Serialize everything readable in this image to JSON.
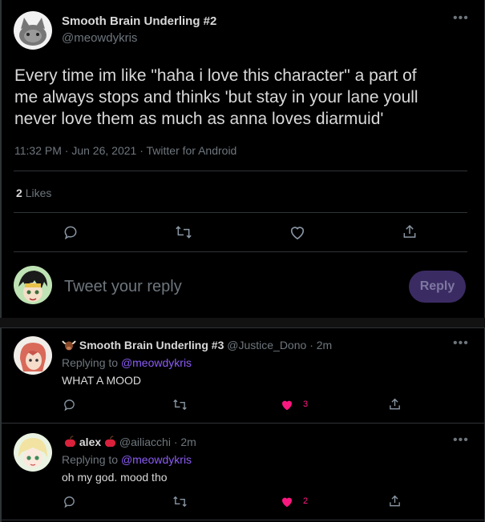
{
  "main_tweet": {
    "display_name": "Smooth Brain Underling #2",
    "handle": "@meowdykris",
    "text_lines": [
      "Every time im like \"haha i love this character\" a part of",
      "me always stops and thinks 'but stay in your lane youll",
      "never love them as much as anna loves diarmuid'"
    ],
    "time": "11:32 PM",
    "date": "Jun 26, 2021",
    "source": "Twitter for Android",
    "likes_count": "2",
    "likes_label": "Likes"
  },
  "reply_box": {
    "placeholder": "Tweet your reply",
    "button_label": "Reply"
  },
  "replies": [
    {
      "display_name": "Smooth Brain Underling #3",
      "handle": "@Justice_Dono",
      "time": "2m",
      "replying_prefix": "Replying to",
      "replying_to": "@meowdykris",
      "text": "WHAT A MOOD",
      "likes": "3"
    },
    {
      "display_name": "alex",
      "handle": "@ailiacchi",
      "time": "2m",
      "replying_prefix": "Replying to",
      "replying_to": "@meowdykris",
      "text": "oh my god. mood tho",
      "likes": "2"
    }
  ],
  "separator": "·",
  "colors": {
    "background": "#000000",
    "text": "#d9d9d9",
    "muted": "#6e767d",
    "accent": "#8b5cf6",
    "like_active": "#f91880",
    "reply_button_bg": "#3b2b63"
  },
  "icons": [
    "more-icon",
    "reply-icon",
    "retweet-icon",
    "like-icon",
    "share-icon",
    "bull-emoji-icon",
    "apple-emoji-icon"
  ]
}
